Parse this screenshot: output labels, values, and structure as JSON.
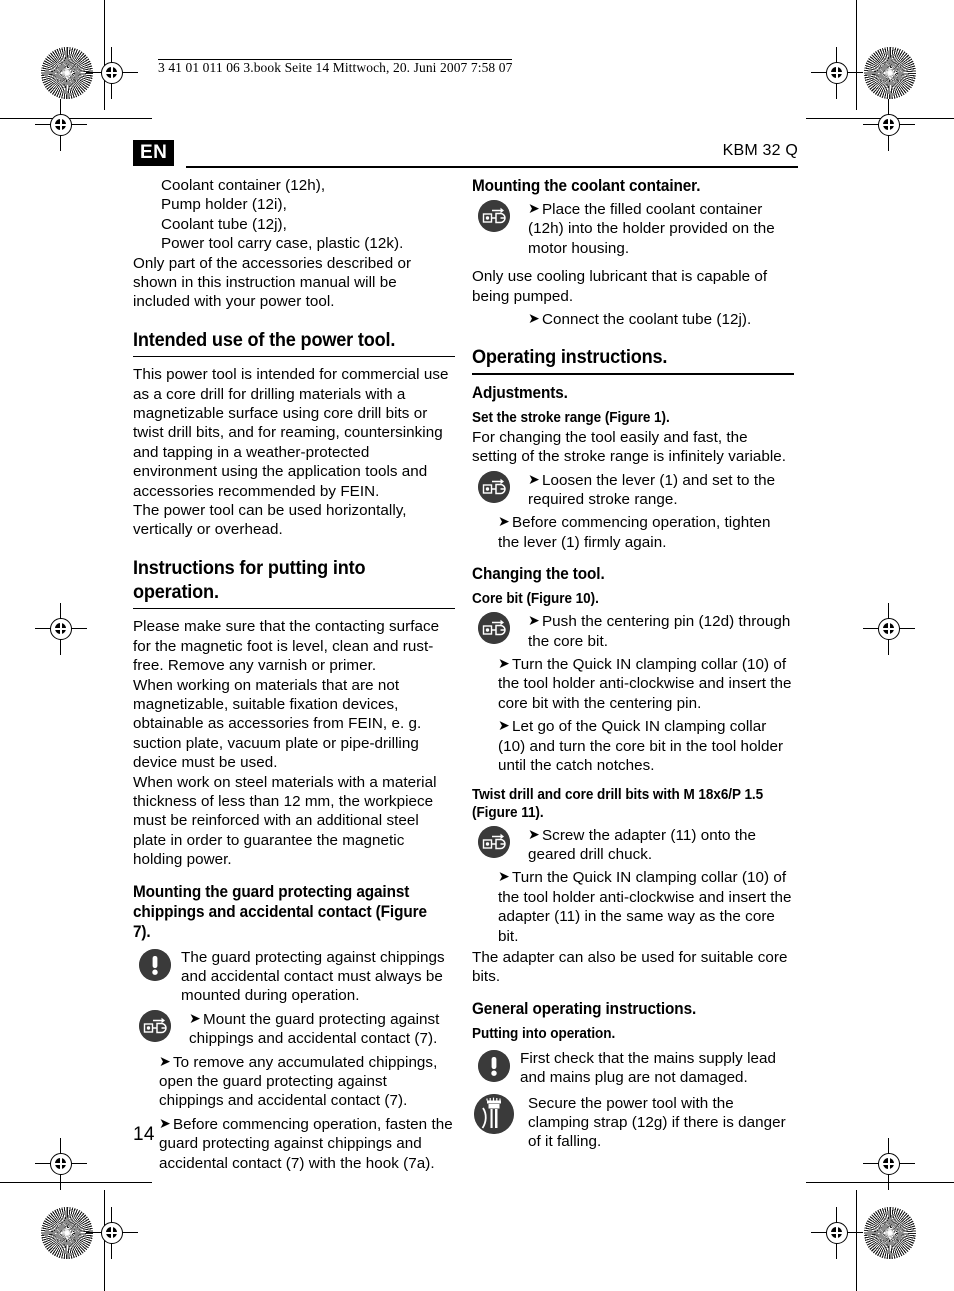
{
  "print_marks": {
    "file_info": "3 41 01 011 06 3.book  Seite 14  Mittwoch, 20. Juni 2007  7:58 07",
    "rosette_label": "print-control-rosette",
    "registration_label": "registration-crosshair"
  },
  "running_head": {
    "language_badge": "EN",
    "model": "KBM 32 Q"
  },
  "page_number": "14",
  "left_column": {
    "accessory_list": [
      "Coolant container (12h),",
      "Pump holder (12i),",
      "Coolant tube (12j),",
      "Power tool carry case, plastic (12k)."
    ],
    "accessory_note": "Only part of the accessories described or shown in this instruction manual will be included with your power tool.",
    "intended_use": {
      "heading": "Intended use of the power tool.",
      "paragraphs": [
        "This power tool is intended for commercial use as a core drill for drilling materials with a magnetizable surface using core drill bits or twist drill bits, and for reaming, countersinking and tapping in a weather-protected environment using the application tools and accessories recommended by FEIN.",
        "The power tool can be used horizontally, vertically or overhead."
      ]
    },
    "putting_into_operation": {
      "heading": "Instructions for putting into operation.",
      "paragraphs": [
        "Please make sure that the contacting surface for the magnetic foot is level, clean and rust-free. Remove any varnish or primer.",
        "When working on materials that are not magnetizable, suitable fixation devices, obtainable as accessories from FEIN, e. g. suction plate, vacuum plate or pipe-drilling device must be used.",
        "When work on steel materials with a material thickness of less than 12 mm, the workpiece must be reinforced with an additional steel plate in order to guarantee the magnetic holding power."
      ]
    },
    "guard_section": {
      "heading": "Mounting the guard protecting against chippings and accidental contact (Figure 7).",
      "warning": "The guard protecting against chippings and accidental contact must always be mounted during operation.",
      "actions": [
        "Mount the guard protecting against chippings and accidental contact (7).",
        "To remove any accumulated chippings, open the guard protecting against chippings and accidental contact (7).",
        "Before commencing operation, fasten the guard protecting against chippings and accidental contact (7) with the hook (7a)."
      ]
    }
  },
  "right_column": {
    "coolant_section": {
      "heading": "Mounting the coolant container.",
      "action_first": "Place the filled coolant container (12h) into the holder provided on the motor housing.",
      "note": "Only use cooling lubricant that is capable of being pumped.",
      "action_last": "Connect the coolant tube (12j)."
    },
    "operating_instructions": {
      "heading": "Operating instructions.",
      "adjustments_heading": "Adjustments.",
      "stroke_range_heading": "Set the stroke range (Figure 1).",
      "stroke_range_text": "For changing the tool easily and fast, the setting of the stroke range is infinitely variable.",
      "stroke_actions": [
        "Loosen the lever (1) and set to the required stroke range.",
        "Before commencing operation, tighten the lever (1) firmly again."
      ]
    },
    "changing_tool": {
      "heading": "Changing the tool.",
      "core_bit_heading": "Core bit (Figure 10).",
      "core_bit_actions": [
        "Push the centering pin (12d) through the core bit.",
        "Turn the Quick IN clamping collar (10) of the tool holder anti-clockwise and insert the core bit with the centering pin.",
        "Let go of the Quick IN clamping collar (10) and turn the core bit in the tool holder until the catch notches."
      ],
      "twist_drill_heading": "Twist drill and core drill bits with M 18x6/P 1.5 (Figure 11).",
      "twist_drill_actions": [
        "Screw the adapter (11) onto the geared drill chuck.",
        "Turn the Quick IN clamping collar (10) of the tool holder anti-clockwise and insert the adapter (11) in the same way as the core bit."
      ],
      "adapter_note": "The adapter can also be used for suitable core bits."
    },
    "general_operating": {
      "heading": "General operating instructions.",
      "putting_heading": "Putting into operation.",
      "warning": "First check that the mains supply lead and mains plug are not damaged.",
      "strap_note": "Secure the power tool with the clamping strap (12g) if there is danger of it falling."
    }
  },
  "symbols": {
    "arrow": "➤",
    "warning_icon": "warning-exclamation-icon",
    "mount_icon": "mounting-action-icon",
    "strap_icon": "clamping-strap-icon"
  },
  "colors": {
    "text": "#000000",
    "icon_circle": "#3a3a3a",
    "badge_bg": "#000000",
    "badge_fg": "#ffffff"
  }
}
